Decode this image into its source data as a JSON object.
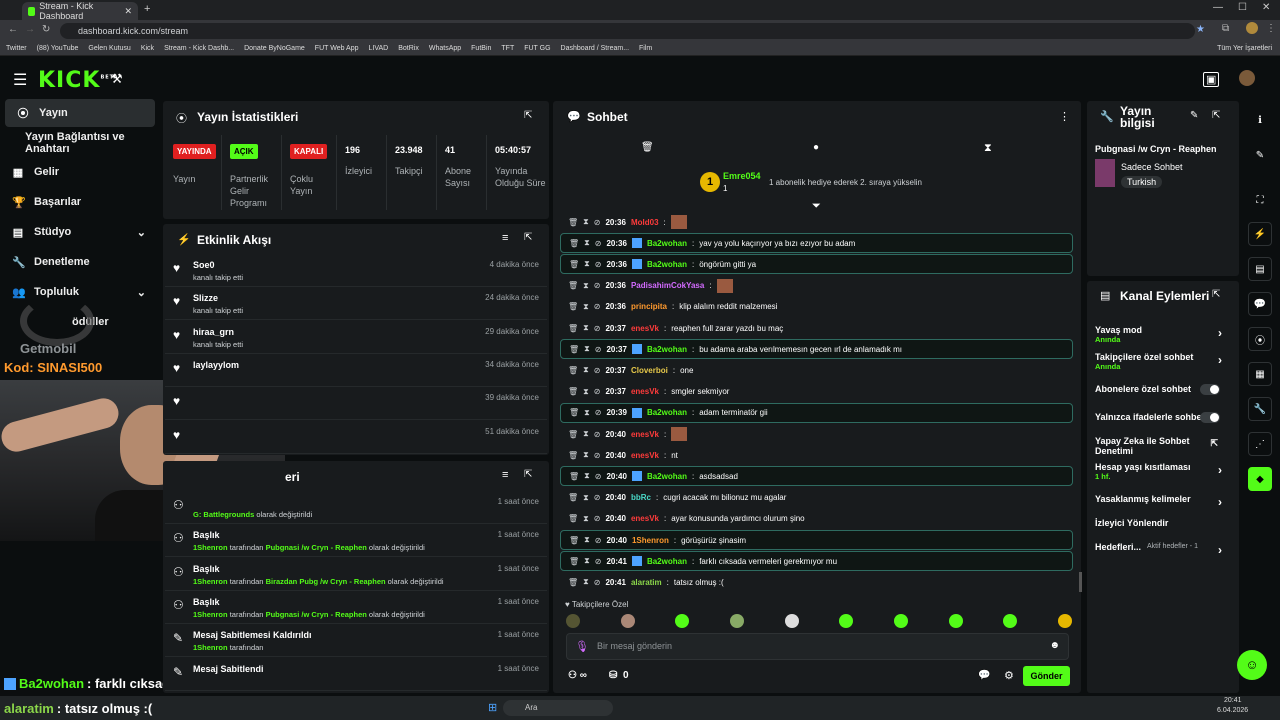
{
  "browser": {
    "tab_title": "Stream - Kick Dashboard",
    "url": "dashboard.kick.com/stream",
    "bookmarks": [
      "Twitter",
      "(88) YouTube",
      "Gelen Kutusu",
      "Kick",
      "Stream - Kick Dashb...",
      "Donate ByNoGame",
      "FUT Web App",
      "LIVAD",
      "BotRix",
      "WhatsApp",
      "FutBin",
      "TFT",
      "FUT GG",
      "Dashboard / Stream...",
      "Film"
    ],
    "all_bookmarks": "Tüm Yer İşaretleri"
  },
  "brand": {
    "logo": "KICK",
    "beta": "BETA"
  },
  "sidebar": {
    "items": [
      {
        "label": "Yayın"
      },
      {
        "label": "Yayın Bağlantısı ve Anahtarı"
      },
      {
        "label": "Gelir"
      },
      {
        "label": "Başarılar"
      },
      {
        "label": "Stüdyo"
      },
      {
        "label": "Denetleme"
      },
      {
        "label": "Topluluk"
      },
      {
        "label": "ödüller"
      }
    ]
  },
  "overlay": {
    "sponsor": "Getmobil",
    "code": "Kod: SINASI500",
    "chat_line1_user": "Ba2wohan",
    "chat_line1_text": ": farklı cıksada vermeleri gerekmıyor mu",
    "chat_line2_user": "alaratim",
    "chat_line2_text": ": tatsız olmuş :("
  },
  "stats": {
    "title": "Yayın İstatistikleri",
    "items": [
      {
        "badge": "YAYINDA",
        "label": "Yayın"
      },
      {
        "badge": "AÇIK",
        "label": "Partnerlik Gelir Programı"
      },
      {
        "badge": "KAPALI",
        "label": "Çoklu Yayın"
      },
      {
        "value": "196",
        "label": "İzleyici"
      },
      {
        "value": "23.948",
        "label": "Takipçi"
      },
      {
        "value": "41",
        "label": "Abone Sayısı"
      },
      {
        "value": "05:40:57",
        "label": "Yayında Olduğu Süre"
      }
    ]
  },
  "activity": {
    "title": "Etkinlik Akışı",
    "items": [
      {
        "name": "Soe0",
        "desc": "kanalı takip etti",
        "time": "4 dakika önce"
      },
      {
        "name": "Slizze",
        "desc": "kanalı takip etti",
        "time": "24 dakika önce"
      },
      {
        "name": "hiraa_grn",
        "desc": "kanalı takip etti",
        "time": "29 dakika önce"
      },
      {
        "name": "laylayylom",
        "desc": "",
        "time": "34 dakika önce"
      },
      {
        "name": "",
        "desc": "",
        "time": "39 dakika önce"
      },
      {
        "name": "",
        "desc": "",
        "time": "51 dakika önce"
      }
    ]
  },
  "moderation": {
    "title_fragment": "eri",
    "items": [
      {
        "name": "",
        "desc_hl": "G: Battlegrounds",
        "desc": "olarak değiştirildi",
        "time": "1 saat önce"
      },
      {
        "name": "Başlık",
        "user": "1Shenron",
        "mid": "tarafından",
        "hl": "Pubgnasi /w Cryn - Reaphen",
        "desc": "olarak değiştirildi",
        "time": "1 saat önce"
      },
      {
        "name": "Başlık",
        "user": "1Shenron",
        "mid": "tarafından",
        "hl": "Birazdan Pubg /w Cryn - Reaphen",
        "desc": "olarak değiştirildi",
        "time": "1 saat önce"
      },
      {
        "name": "Başlık",
        "user": "1Shenron",
        "mid": "tarafından",
        "hl": "Pubgnasi /w Cryn - Reaphen",
        "desc": "olarak değiştirildi",
        "time": "1 saat önce"
      },
      {
        "name": "Mesaj Sabitlemesi Kaldırıldı",
        "user": "1Shenron",
        "mid": "tarafından",
        "hl": "",
        "desc": "",
        "time": "1 saat önce"
      },
      {
        "name": "Mesaj Sabitlendi",
        "user": "",
        "mid": "",
        "hl": "",
        "desc": "",
        "time": "1 saat önce"
      }
    ]
  },
  "chat": {
    "title": "Sohbet",
    "gift": {
      "user": "Emre054",
      "count": "1",
      "text": "1 abonelik hediye ederek 2. sıraya yükselin"
    },
    "colors": {
      "green": "#53fc18",
      "red": "#ff3b3b",
      "pink": "#d36bff",
      "orange": "#ff9a2e",
      "yellow": "#e6c84a",
      "teal": "#4ad9c8",
      "blue": "#4da3ff",
      "lime": "#8bd64a"
    },
    "messages": [
      {
        "time": "20:36",
        "user": "Mold03",
        "color": "red",
        "text": "",
        "hl": false
      },
      {
        "time": "20:36",
        "user": "Ba2wohan",
        "color": "green",
        "text": "yav ya yolu kaçırıyor ya bızı ezıyor bu adam",
        "hl": true
      },
      {
        "time": "20:36",
        "user": "Ba2wohan",
        "color": "green",
        "text": "öngörüm gitti ya",
        "hl": true
      },
      {
        "time": "20:36",
        "user": "PadisahimCokYasa",
        "color": "pink",
        "text": "",
        "hl": false
      },
      {
        "time": "20:36",
        "user": "principita",
        "color": "orange",
        "text": "klip alalım reddit malzemesi",
        "hl": false
      },
      {
        "time": "20:37",
        "user": "enesVk",
        "color": "red",
        "text": "reaphen full zarar yazdı bu maç",
        "hl": false
      },
      {
        "time": "20:37",
        "user": "Ba2wohan",
        "color": "green",
        "text": "bu adama araba verılmemesın gecen ırl de anlamadık mı",
        "hl": true
      },
      {
        "time": "20:37",
        "user": "Cloverboi",
        "color": "yellow",
        "text": "one",
        "hl": false
      },
      {
        "time": "20:37",
        "user": "enesVk",
        "color": "red",
        "text": "smgler sekmiyor",
        "hl": false
      },
      {
        "time": "20:39",
        "user": "Ba2wohan",
        "color": "green",
        "text": "adam terminatör gii",
        "hl": true
      },
      {
        "time": "20:40",
        "user": "enesVk",
        "color": "red",
        "text": "",
        "hl": false
      },
      {
        "time": "20:40",
        "user": "enesVk",
        "color": "red",
        "text": "nt",
        "hl": false
      },
      {
        "time": "20:40",
        "user": "Ba2wohan",
        "color": "green",
        "text": "asdsadsad",
        "hl": true
      },
      {
        "time": "20:40",
        "user": "bbRc",
        "color": "teal",
        "text": "cugri acacak mı bilionuz mu agalar",
        "hl": false
      },
      {
        "time": "20:40",
        "user": "enesVk",
        "color": "red",
        "text": "ayar konusunda yardımcı olurum şino",
        "hl": false
      },
      {
        "time": "20:40",
        "user": "1Shenron",
        "color": "orange",
        "text": "görüşürüz şinasim",
        "hl": true
      },
      {
        "time": "20:41",
        "user": "Ba2wohan",
        "color": "green",
        "text": "farklı cıksada vermeleri gerekmıyor mu",
        "hl": true
      },
      {
        "time": "20:41",
        "user": "alaratim",
        "color": "lime",
        "text": "tatsız olmuş :(",
        "hl": false
      }
    ],
    "followers_only": "Takipçilere Özel",
    "placeholder": "Bir mesaj gönderin",
    "viewers_icon_text": "∞",
    "points": "0",
    "send": "Gönder"
  },
  "stream_info": {
    "title": "Yayın bilgisi",
    "stream_title": "Pubgnasi /w Cryn - Reaphen",
    "category": "Sadece Sohbet",
    "tag": "Turkish"
  },
  "channel_actions": {
    "title": "Kanal Eylemleri",
    "items": [
      {
        "label": "Yavaş mod",
        "sub": "Anında",
        "kind": "arrow"
      },
      {
        "label": "Takipçilere özel sohbet",
        "sub": "Anında",
        "kind": "arrow"
      },
      {
        "label": "Abonelere özel sohbet",
        "sub": "",
        "kind": "toggle"
      },
      {
        "label": "Yalnızca ifadelerle sohbet",
        "sub": "",
        "kind": "toggle"
      },
      {
        "label": "Yapay Zeka ile Sohbet Denetimi",
        "sub": "",
        "kind": "ext"
      },
      {
        "label": "Hesap yaşı kısıtlaması",
        "sub": "1 hf.",
        "kind": "arrow"
      },
      {
        "label": "Yasaklanmış kelimeler",
        "sub": "",
        "kind": "arrow"
      },
      {
        "label": "İzleyici Yönlendir",
        "sub": "",
        "kind": "none"
      },
      {
        "label": "Hedefleri...",
        "sub": "Aktif hedefler - 1",
        "kind": "arrow"
      }
    ]
  },
  "taskbar": {
    "search": "Ara",
    "time": "20:41",
    "date": "6.04.2026"
  }
}
